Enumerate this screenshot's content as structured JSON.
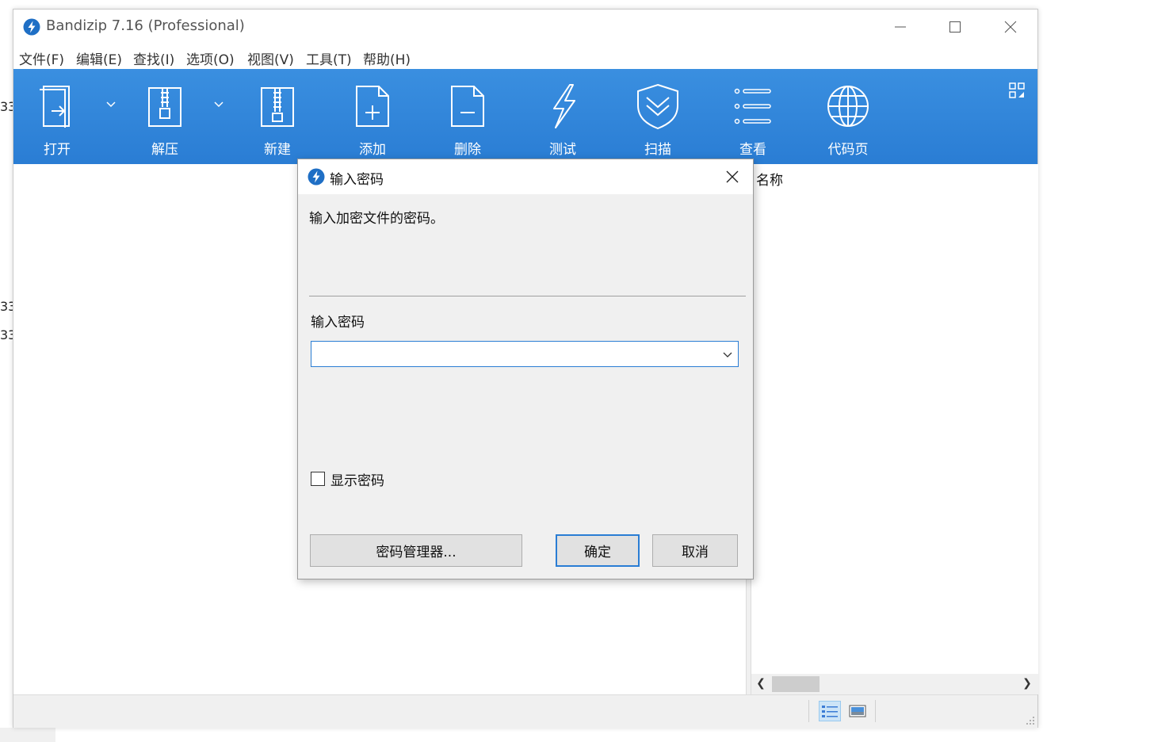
{
  "background": {
    "side_numbers": [
      "33",
      "33",
      "33"
    ]
  },
  "window": {
    "title": "Bandizip 7.16 (Professional)",
    "controls": {
      "minimize": "minimize-icon",
      "maximize": "maximize-icon",
      "close": "close-icon"
    }
  },
  "menu": {
    "items": [
      "文件(F)",
      "编辑(E)",
      "查找(I)",
      "选项(O)",
      "视图(V)",
      "工具(T)",
      "帮助(H)"
    ]
  },
  "toolbar": {
    "colors": {
      "background": "#2a7dd4",
      "label": "#ffffff"
    },
    "tools": [
      {
        "label": "打开",
        "icon": "open-archive-icon"
      },
      {
        "label": "解压",
        "icon": "extract-icon"
      },
      {
        "label": "新建",
        "icon": "new-archive-icon"
      },
      {
        "label": "添加",
        "icon": "add-file-icon"
      },
      {
        "label": "删除",
        "icon": "delete-file-icon"
      },
      {
        "label": "测试",
        "icon": "test-lightning-icon"
      },
      {
        "label": "扫描",
        "icon": "scan-shield-icon"
      },
      {
        "label": "查看",
        "icon": "view-list-icon"
      },
      {
        "label": "代码页",
        "icon": "codepage-globe-icon"
      }
    ]
  },
  "file_list": {
    "column_header": "名称"
  },
  "dialog": {
    "title": "输入密码",
    "description": "输入加密文件的密码。",
    "password_label": "输入密码",
    "password_value": "",
    "password_placeholder": "",
    "show_password_label": "显示密码",
    "show_password_checked": false,
    "buttons": {
      "manager": "密码管理器...",
      "ok": "确定",
      "cancel": "取消"
    }
  }
}
